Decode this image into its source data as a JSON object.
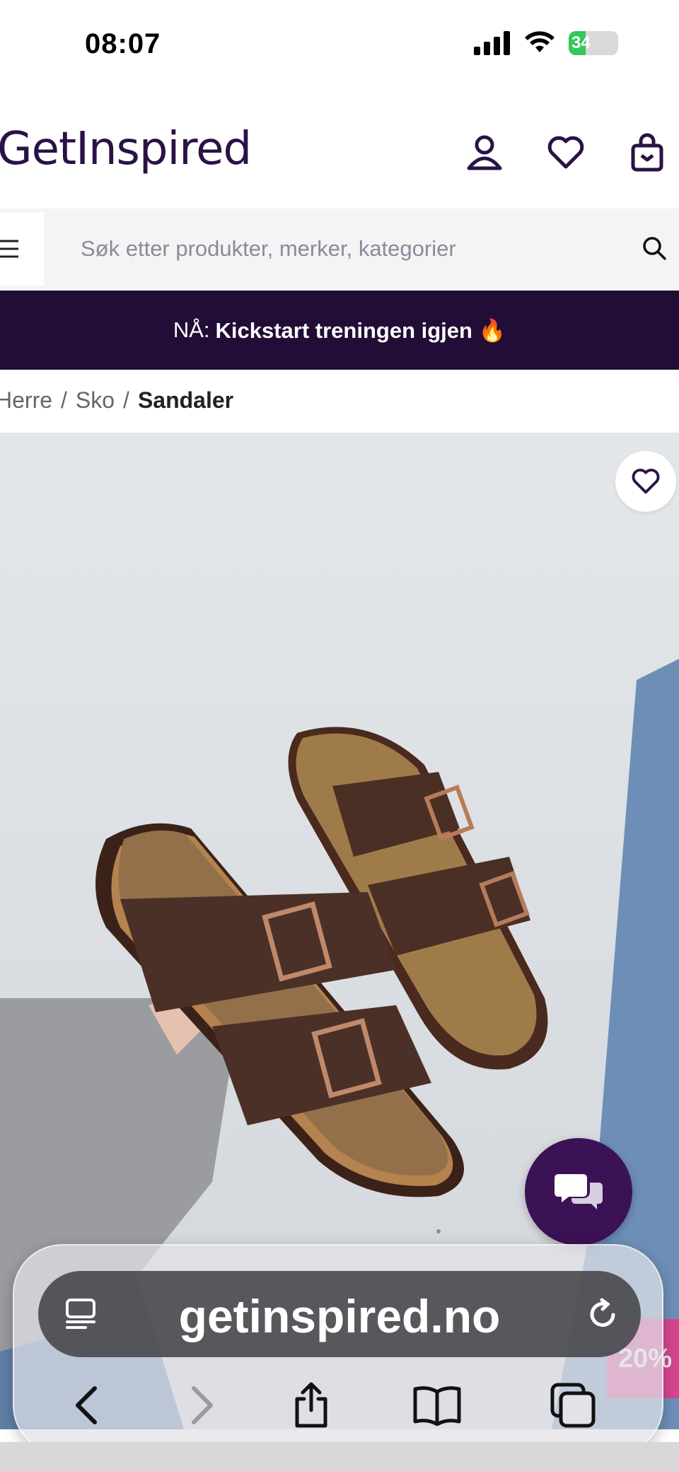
{
  "status_bar": {
    "time": "08:07",
    "battery": "34"
  },
  "header": {
    "logo": "GetInspired"
  },
  "search": {
    "placeholder": "Søk etter produkter, merker, kategorier"
  },
  "promo": {
    "prefix": "NÅ:",
    "text": "Kickstart treningen igjen 🔥"
  },
  "breadcrumb": {
    "items": [
      "Herre",
      "Sko",
      "Sandaler"
    ],
    "separator": "/"
  },
  "product": {
    "image_alt": "Birkenstock sandaler"
  },
  "badge": {
    "text": "20%"
  },
  "browser": {
    "url": "getinspired.no"
  },
  "colors": {
    "brand": "#2a1245",
    "banner": "#210d35",
    "chat": "#3b1256",
    "badge": "#e9398c"
  },
  "icons": [
    "signal-icon",
    "wifi-icon",
    "battery-icon",
    "account-icon",
    "heart-icon",
    "cart-icon",
    "menu-icon",
    "search-icon",
    "chat-icon",
    "tab-overview-icon",
    "reload-icon",
    "back-icon",
    "forward-icon",
    "share-icon",
    "bookmarks-icon",
    "tabs-icon"
  ]
}
